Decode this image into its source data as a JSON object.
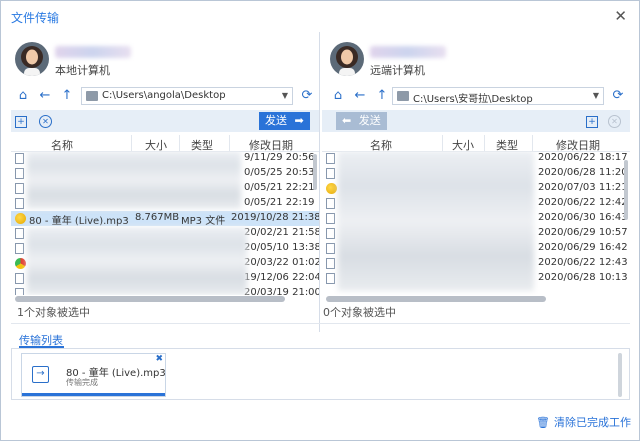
{
  "window": {
    "title": "文件传输",
    "close_glyph": "✕"
  },
  "left": {
    "pc_label": "本地计算机",
    "path": "C:\\Users\\angola\\Desktop",
    "send_label": "发送",
    "columns": [
      "名称",
      "大小",
      "类型",
      "修改日期"
    ],
    "rows": [
      {
        "name": "",
        "size": "",
        "type": "",
        "date": "9/11/29 20:56",
        "icon": "doc"
      },
      {
        "name": "",
        "size": "",
        "type": "",
        "date": "0/05/25 20:53",
        "icon": "doc"
      },
      {
        "name": "",
        "size": "",
        "type": "",
        "date": "0/05/21 22:21",
        "icon": "doc"
      },
      {
        "name": "",
        "size": "",
        "type": "",
        "date": "0/05/21 22:19",
        "icon": "doc"
      },
      {
        "name": "80 - 童年 (Live).mp3",
        "size": "8.767MB",
        "type": "MP3 文件",
        "date": "2019/10/28 21:38",
        "icon": "mp3",
        "selected": true
      },
      {
        "name": "",
        "size": "",
        "type": "",
        "date": "20/02/21 21:58",
        "icon": "doc"
      },
      {
        "name": "",
        "size": "",
        "type": "",
        "date": "20/05/10 13:38",
        "icon": "doc"
      },
      {
        "name": "",
        "size": "",
        "type": "",
        "date": "20/03/22 01:02",
        "icon": "chrome"
      },
      {
        "name": "",
        "size": "",
        "type": "",
        "date": "19/12/06 22:04",
        "icon": "doc"
      },
      {
        "name": "",
        "size": "",
        "type": "",
        "date": "20/03/19 21:00",
        "icon": "doc"
      }
    ],
    "status": "1个对象被选中"
  },
  "right": {
    "pc_label": "远端计算机",
    "path": "C:\\Users\\安哥拉\\Desktop",
    "send_label": "发送",
    "columns": [
      "名称",
      "大小",
      "类型",
      "修改日期"
    ],
    "rows": [
      {
        "date": "2020/06/22 18:17",
        "icon": "doc"
      },
      {
        "date": "2020/06/28 11:20",
        "icon": "doc"
      },
      {
        "date": "2020/07/03 11:21",
        "icon": "mp3"
      },
      {
        "date": "2020/06/22 12:42",
        "icon": "doc"
      },
      {
        "date": "2020/06/30 16:43",
        "icon": "doc"
      },
      {
        "date": "2020/06/29 10:57",
        "icon": "doc"
      },
      {
        "date": "2020/06/29 16:42",
        "icon": "doc"
      },
      {
        "date": "2020/06/22 12:43",
        "icon": "doc"
      },
      {
        "date": "2020/06/28 10:13",
        "icon": "doc"
      }
    ],
    "status": "0个对象被选中"
  },
  "transfer": {
    "tab_label": "传输列表",
    "items": [
      {
        "name": "80 - 童年 (Live).mp3",
        "status": "传输完成",
        "progress": 1.0
      }
    ],
    "clear_label": "清除已完成工作"
  },
  "colors": {
    "accent": "#2a73d8",
    "selected_row": "#cde3f8",
    "toolbar_bg": "#e6eef7"
  }
}
